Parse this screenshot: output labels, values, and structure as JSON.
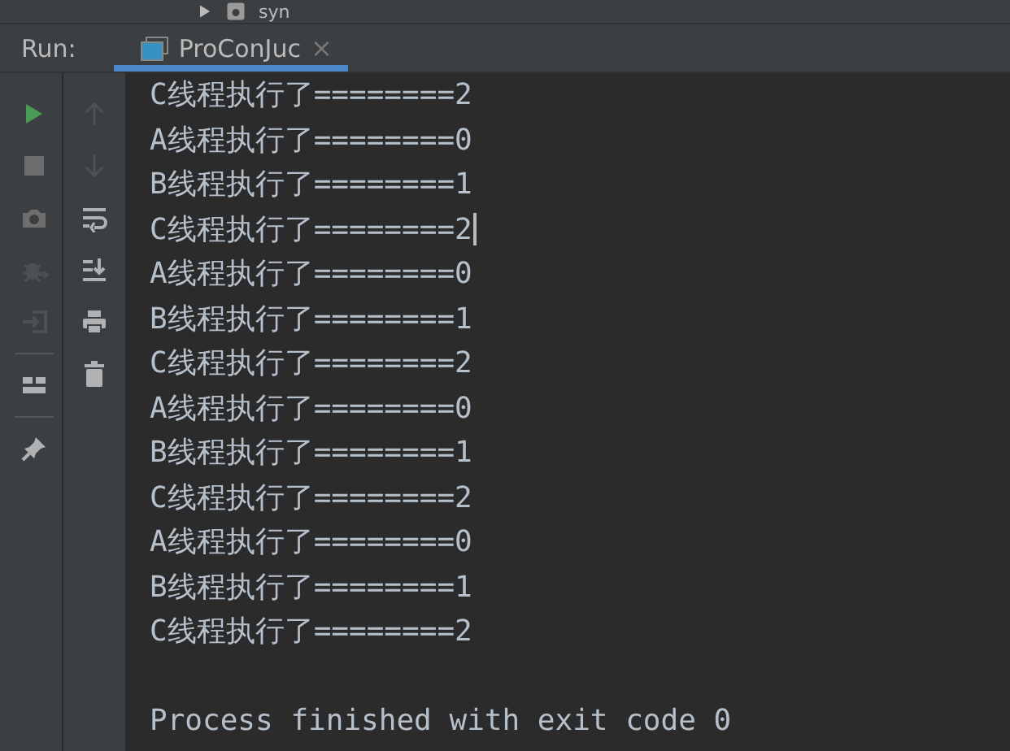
{
  "tree_row": {
    "label": "syn"
  },
  "run_panel": {
    "title": "Run:",
    "tabs": [
      {
        "label": "ProConJuc",
        "close": "×",
        "selected": true
      }
    ]
  },
  "left_toolbar": [
    {
      "kind": "run",
      "disabled": false
    },
    {
      "kind": "stop",
      "disabled": false
    },
    {
      "kind": "camera",
      "disabled": false
    },
    {
      "kind": "bug",
      "disabled": true
    },
    {
      "kind": "exit",
      "disabled": true
    },
    {
      "kind": "separator"
    },
    {
      "kind": "layout",
      "disabled": false
    },
    {
      "kind": "separator"
    },
    {
      "kind": "pin",
      "disabled": false
    }
  ],
  "console_toolbar": [
    {
      "kind": "up",
      "disabled": true
    },
    {
      "kind": "down",
      "disabled": true
    },
    {
      "kind": "wrap",
      "disabled": false
    },
    {
      "kind": "scroll-end",
      "disabled": false
    },
    {
      "kind": "print",
      "disabled": false
    },
    {
      "kind": "trash",
      "disabled": false
    }
  ],
  "console_lines": [
    {
      "text": "C线程执行了========2",
      "cursor": false
    },
    {
      "text": "A线程执行了========0",
      "cursor": false
    },
    {
      "text": "B线程执行了========1",
      "cursor": false
    },
    {
      "text": "C线程执行了========2",
      "cursor": true
    },
    {
      "text": "A线程执行了========0",
      "cursor": false
    },
    {
      "text": "B线程执行了========1",
      "cursor": false
    },
    {
      "text": "C线程执行了========2",
      "cursor": false
    },
    {
      "text": "A线程执行了========0",
      "cursor": false
    },
    {
      "text": "B线程执行了========1",
      "cursor": false
    },
    {
      "text": "C线程执行了========2",
      "cursor": false
    },
    {
      "text": "A线程执行了========0",
      "cursor": false
    },
    {
      "text": "B线程执行了========1",
      "cursor": false
    },
    {
      "text": "C线程执行了========2",
      "cursor": false
    },
    {
      "cursor": false
    },
    {
      "text": "Process finished with exit code 0",
      "cursor": false
    }
  ]
}
